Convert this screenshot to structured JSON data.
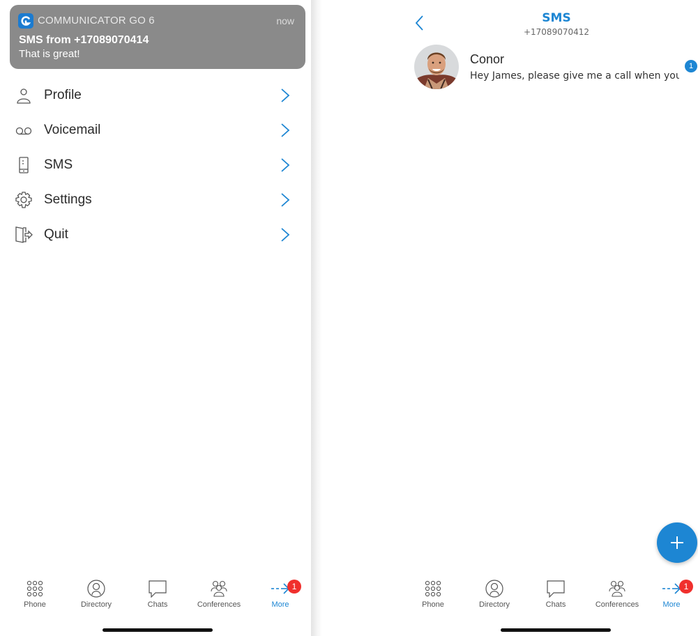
{
  "notification": {
    "app_name": "COMMUNICATOR GO 6",
    "time": "now",
    "title": "SMS from +17089070414",
    "body": "That is great!"
  },
  "menu": {
    "items": [
      {
        "label": "Profile",
        "icon": "person-icon"
      },
      {
        "label": "Voicemail",
        "icon": "voicemail-icon"
      },
      {
        "label": "SMS",
        "icon": "phone-device-icon"
      },
      {
        "label": "Settings",
        "icon": "gear-icon"
      },
      {
        "label": "Quit",
        "icon": "exit-icon"
      }
    ]
  },
  "tabbar": {
    "tabs": [
      {
        "label": "Phone",
        "icon": "keypad-icon"
      },
      {
        "label": "Directory",
        "icon": "contact-icon"
      },
      {
        "label": "Chats",
        "icon": "chat-bubble-icon"
      },
      {
        "label": "Conferences",
        "icon": "group-icon"
      },
      {
        "label": "More",
        "icon": "more-arrow-icon",
        "badge": "1",
        "active": true
      }
    ]
  },
  "sms": {
    "title": "SMS",
    "number": "+17089070412",
    "conversations": [
      {
        "name": "Conor",
        "preview": "Hey James, please give me a call when you ar...",
        "unread": "1"
      }
    ],
    "compose_icon": "plus-icon"
  },
  "colors": {
    "accent": "#1d86d3",
    "badge_red": "#f0302d",
    "notification_bg": "#8a8a8a"
  }
}
